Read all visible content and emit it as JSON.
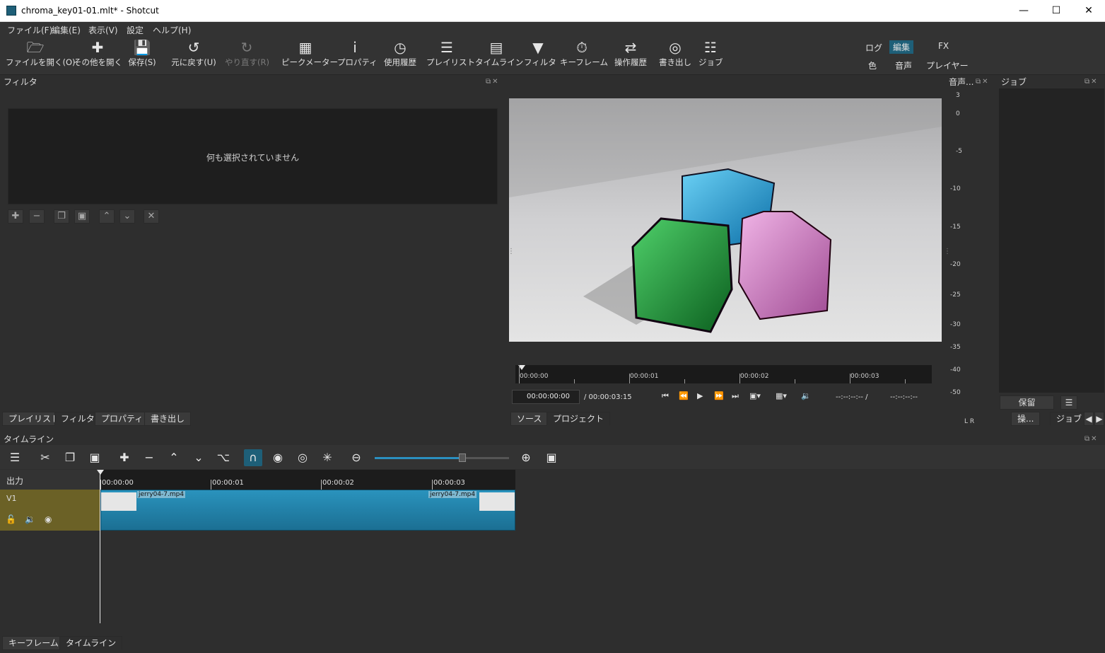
{
  "window": {
    "title": "chroma_key01-01.mlt* - Shotcut"
  },
  "menu": [
    "ファイル(F)",
    "編集(E)",
    "表示(V)",
    "設定",
    "ヘルプ(H)"
  ],
  "toolbar": [
    {
      "label": "ファイルを開く(O)",
      "icon": "folder-open-icon"
    },
    {
      "label": "その他を開く",
      "icon": "open-other-icon"
    },
    {
      "label": "保存(S)",
      "icon": "save-icon"
    },
    {
      "label": "元に戻す(U)",
      "icon": "undo-icon"
    },
    {
      "label": "やり直す(R)",
      "icon": "redo-icon",
      "disabled": true
    },
    {
      "label": "ピークメーター",
      "icon": "peak-meter-icon"
    },
    {
      "label": "プロパティ",
      "icon": "info-icon"
    },
    {
      "label": "使用履歴",
      "icon": "clock-icon"
    },
    {
      "label": "プレイリスト",
      "icon": "list-icon"
    },
    {
      "label": "タイムライン",
      "icon": "timeline-icon"
    },
    {
      "label": "フィルタ",
      "icon": "funnel-icon"
    },
    {
      "label": "キーフレーム",
      "icon": "stopwatch-icon"
    },
    {
      "label": "操作履歴",
      "icon": "history-icon"
    },
    {
      "label": "書き出し",
      "icon": "disc-icon"
    },
    {
      "label": "ジョブ",
      "icon": "jobs-icon"
    }
  ],
  "layout_modes": {
    "row1": [
      "ログ",
      "編集",
      "FX"
    ],
    "row2": [
      "色",
      "音声",
      "プレイヤー"
    ],
    "active": "編集"
  },
  "filters": {
    "title": "フィルタ",
    "empty_text": "何も選択されていません"
  },
  "left_tabs": [
    "プレイリスト",
    "フィルタ",
    "プロパティ",
    "書き出し"
  ],
  "player": {
    "ruler_labels": [
      "00:00:00",
      "00:00:01",
      "00:00:02",
      "00:00:03"
    ],
    "timecode": "00:00:00:00",
    "duration": "/ 00:00:03:15",
    "in_point": "--:--:--:-- /",
    "out_point": "--:--:--:--",
    "tabs": [
      "ソース",
      "プロジェクト"
    ]
  },
  "audio_meter": {
    "title": "音声...",
    "scale": [
      "3",
      "0",
      "-5",
      "-10",
      "-15",
      "-20",
      "-25",
      "-30",
      "-35",
      "-40",
      "-50"
    ],
    "channels": "L  R"
  },
  "jobs": {
    "title": "ジョブ",
    "pause_label": "保留",
    "tabs": [
      "操...",
      "ジョブ"
    ]
  },
  "timeline": {
    "title": "タイムライン",
    "output_label": "出力",
    "track_name": "V1",
    "ruler_labels": [
      "00:00:00",
      "00:00:01",
      "00:00:02",
      "00:00:03"
    ],
    "clip_name_start": "jerry04-7.mp4",
    "clip_name_end": "jerry04-7.mp4"
  },
  "bottom_tabs": [
    "キーフレーム",
    "タイムライン"
  ],
  "colors": {
    "accent": "#1e5f78",
    "track": "#6b6126",
    "clip": "#2a93bd"
  }
}
